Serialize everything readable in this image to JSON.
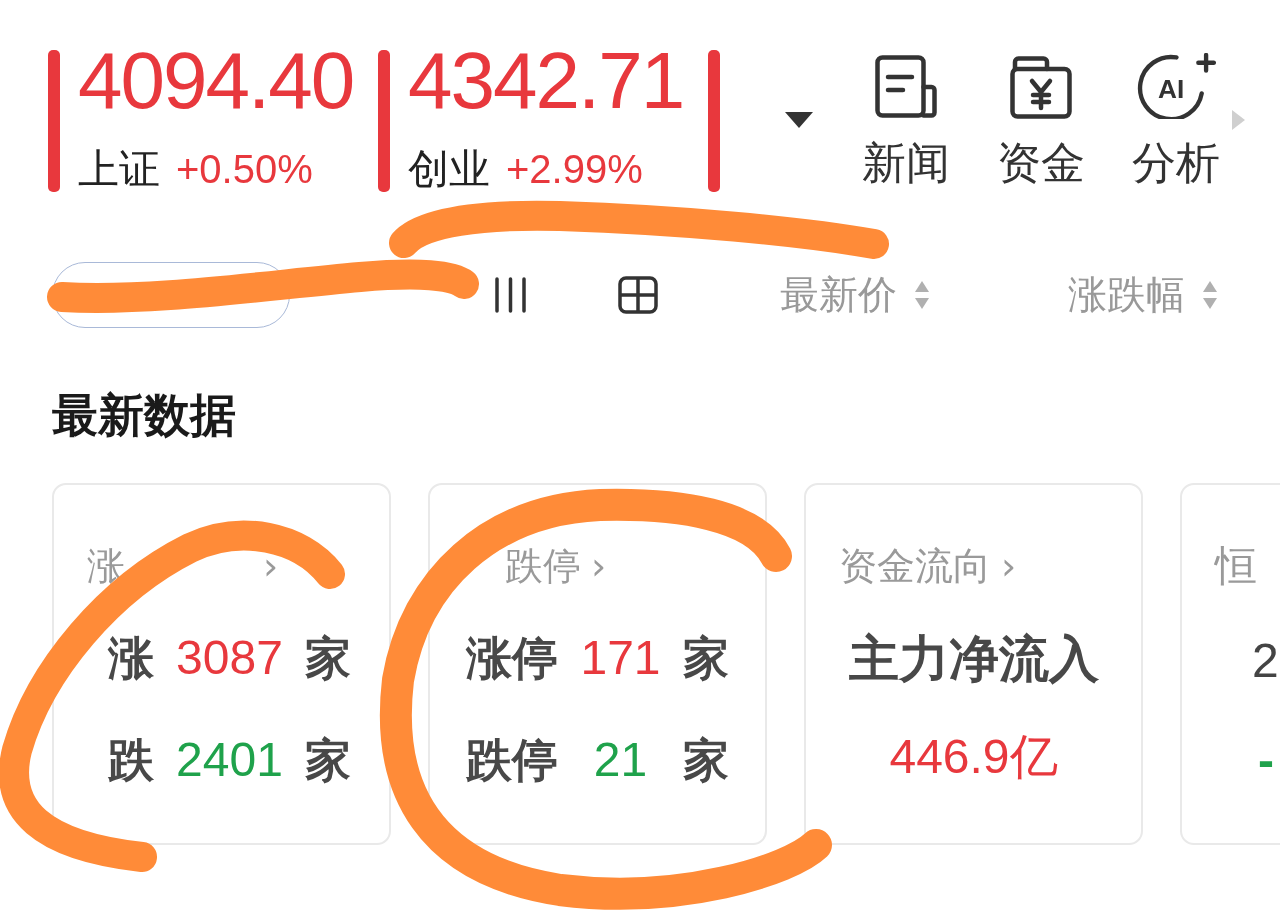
{
  "indices": [
    {
      "value": "4094.40",
      "name": "上证",
      "change": "+0.50%",
      "up": true
    },
    {
      "value": "4342.71",
      "name": "创业",
      "change": "+2.99%",
      "up": true
    },
    {
      "up": true
    }
  ],
  "tools": [
    {
      "kind": "news",
      "label": "新闻"
    },
    {
      "kind": "funds",
      "label": "资金"
    },
    {
      "kind": "ai",
      "icon_text": "AI",
      "label": "分析"
    }
  ],
  "toolbar": {
    "sort_columns": [
      {
        "label": "最新价"
      },
      {
        "label": "涨跌幅"
      }
    ]
  },
  "section_title": "最新数据",
  "cards": [
    {
      "kind": "counts",
      "title": "涨",
      "arrow": "›",
      "rows": [
        {
          "label": "涨",
          "value": "3087",
          "unit": "家",
          "up": true
        },
        {
          "label": "跌",
          "value": "2401",
          "unit": "家",
          "up": false
        }
      ]
    },
    {
      "kind": "counts",
      "title": "跌停",
      "arrow": "›",
      "rows": [
        {
          "label": "涨停",
          "value": "171",
          "unit": "家",
          "up": true
        },
        {
          "label": "跌停",
          "value": "21",
          "unit": "家",
          "up": false
        }
      ]
    },
    {
      "kind": "flow",
      "title": "资金流向",
      "arrow": "›",
      "headline": "主力净流入",
      "value": "446.9亿",
      "up": true
    },
    {
      "kind": "quote",
      "title": "恒",
      "value": "2",
      "change": "-",
      "up": false
    }
  ]
}
